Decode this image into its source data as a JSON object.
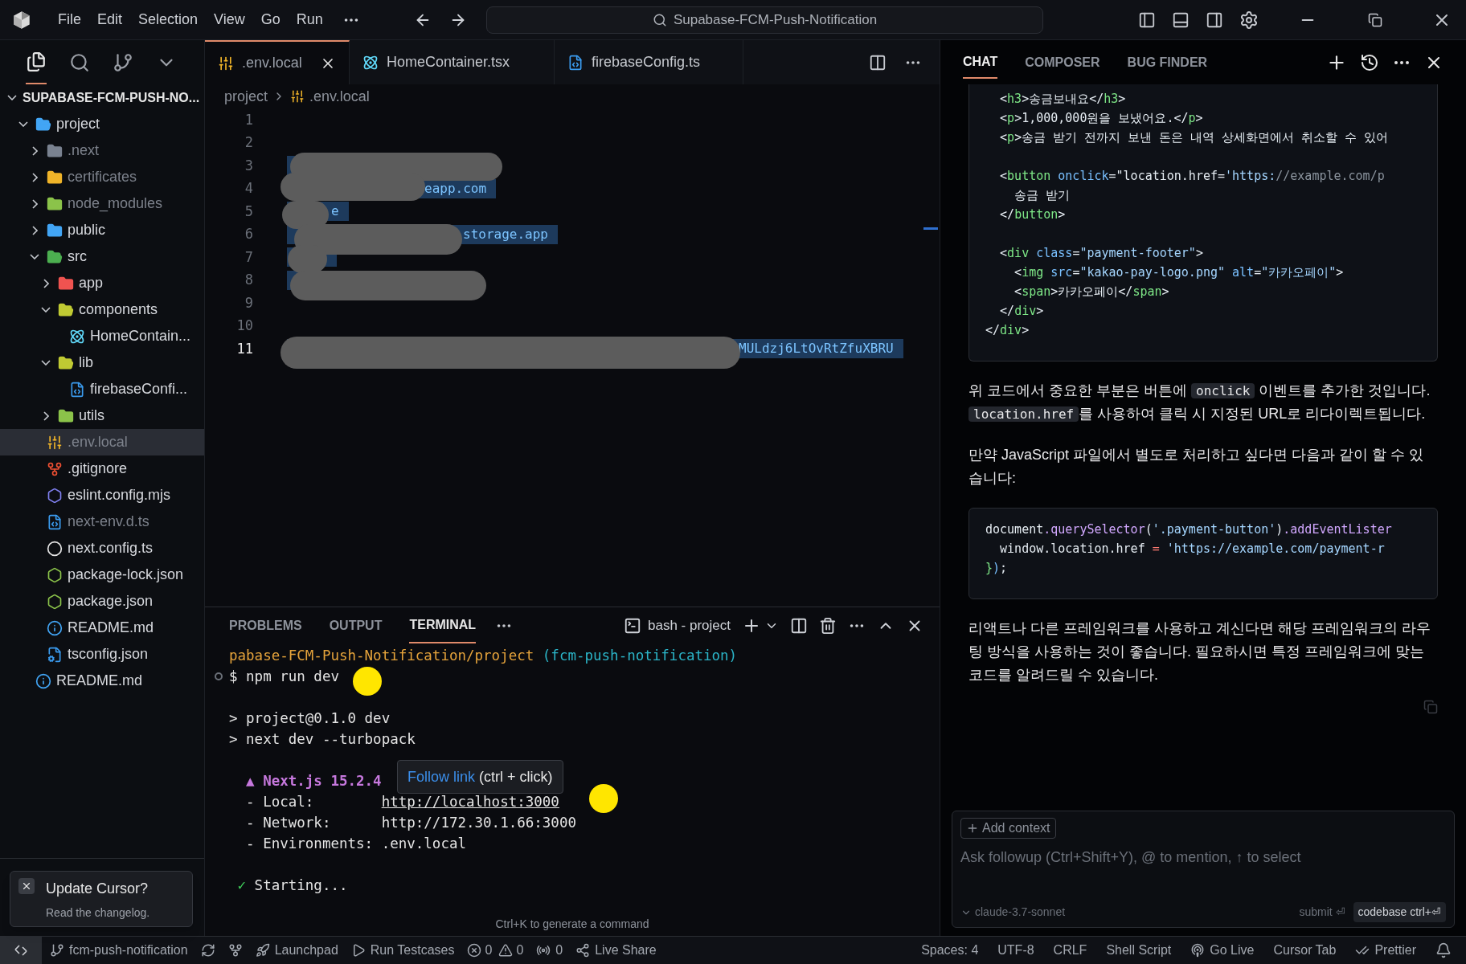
{
  "title_bar": {
    "menus": [
      "File",
      "Edit",
      "Selection",
      "View",
      "Go",
      "Run"
    ],
    "search": "Supabase-FCM-Push-Notification"
  },
  "explorer": {
    "title": "SUPABASE-FCM-PUSH-NO...",
    "tree": [
      {
        "label": "project",
        "kind": "folder",
        "color": "#42a5f5",
        "expanded": true,
        "selected": false,
        "dimmed": false,
        "children": [
          {
            "label": ".next",
            "kind": "folder",
            "color": "#7a8290",
            "expanded": false,
            "selected": false,
            "dimmed": true
          },
          {
            "label": "certificates",
            "kind": "folder",
            "color": "#f0b429",
            "expanded": false,
            "selected": false,
            "dimmed": true
          },
          {
            "label": "node_modules",
            "kind": "folder",
            "color": "#8bc34a",
            "expanded": false,
            "selected": false,
            "dimmed": true
          },
          {
            "label": "public",
            "kind": "folder",
            "color": "#42a5f5",
            "expanded": false,
            "selected": false,
            "dimmed": false
          },
          {
            "label": "src",
            "kind": "folder",
            "color": "#4caf50",
            "expanded": true,
            "selected": false,
            "dimmed": false,
            "children": [
              {
                "label": "app",
                "kind": "folder",
                "color": "#ef5350",
                "expanded": false,
                "selected": false,
                "dimmed": false
              },
              {
                "label": "components",
                "kind": "folder",
                "color": "#c0ca33",
                "expanded": true,
                "selected": false,
                "dimmed": false,
                "children": [
                  {
                    "label": "HomeContain...",
                    "kind": "react",
                    "selected": false,
                    "dimmed": false
                  }
                ]
              },
              {
                "label": "lib",
                "kind": "folder",
                "color": "#c0ca33",
                "expanded": true,
                "selected": false,
                "dimmed": false,
                "children": [
                  {
                    "label": "firebaseConfi...",
                    "kind": "ts",
                    "selected": false,
                    "dimmed": false
                  }
                ]
              },
              {
                "label": "utils",
                "kind": "folder",
                "color": "#8bc34a",
                "expanded": false,
                "selected": false,
                "dimmed": false
              }
            ]
          },
          {
            "label": ".env.local",
            "kind": "env",
            "selected": true,
            "dimmed": true
          },
          {
            "label": ".gitignore",
            "kind": "git",
            "selected": false,
            "dimmed": false
          },
          {
            "label": "eslint.config.mjs",
            "kind": "eslint",
            "selected": false,
            "dimmed": false
          },
          {
            "label": "next-env.d.ts",
            "kind": "ts",
            "selected": false,
            "dimmed": true
          },
          {
            "label": "next.config.ts",
            "kind": "next",
            "selected": false,
            "dimmed": false
          },
          {
            "label": "package-lock.json",
            "kind": "node",
            "selected": false,
            "dimmed": false
          },
          {
            "label": "package.json",
            "kind": "node",
            "selected": false,
            "dimmed": false
          },
          {
            "label": "README.md",
            "kind": "info",
            "selected": false,
            "dimmed": false
          },
          {
            "label": "tsconfig.json",
            "kind": "tsconfig",
            "selected": false,
            "dimmed": false
          }
        ]
      },
      {
        "label": "README.md",
        "kind": "info",
        "selected": false,
        "dimmed": false
      }
    ]
  },
  "toast": {
    "title": "Update Cursor?",
    "message": "Read the changelog."
  },
  "editor": {
    "tabs": [
      {
        "label": ".env.local",
        "kind": "env",
        "selected": true
      },
      {
        "label": "HomeContainer.tsx",
        "kind": "react",
        "selected": false
      },
      {
        "label": "firebaseConfig.ts",
        "kind": "ts",
        "selected": false
      }
    ],
    "breadcrumb": [
      "project",
      ".env.local"
    ],
    "lines": [
      {
        "number": "1",
        "current": false,
        "selected": false,
        "redacted": false
      },
      {
        "number": "2",
        "current": false,
        "selected": false,
        "redacted": false
      },
      {
        "number": "3",
        "current": false,
        "selected": true,
        "redacted": true
      },
      {
        "number": "4",
        "current": false,
        "selected": true,
        "redacted": true,
        "text": "eapp.com"
      },
      {
        "number": "5",
        "current": false,
        "selected": true,
        "redacted": true,
        "text": "e"
      },
      {
        "number": "6",
        "current": false,
        "selected": true,
        "redacted": true,
        "text": "storage.app"
      },
      {
        "number": "7",
        "current": false,
        "selected": true,
        "redacted": true
      },
      {
        "number": "8",
        "current": false,
        "selected": true,
        "redacted": true
      },
      {
        "number": "9",
        "current": false,
        "selected": false,
        "redacted": false
      },
      {
        "number": "10",
        "current": false,
        "selected": false,
        "redacted": false
      },
      {
        "number": "11",
        "current": true,
        "selected": true,
        "redacted": true,
        "text": "MULdzj6LtOvRtZfuXBRU"
      }
    ]
  },
  "panel": {
    "tabs": [
      {
        "label": "PROBLEMS",
        "selected": false
      },
      {
        "label": "OUTPUT",
        "selected": false
      },
      {
        "label": "TERMINAL",
        "selected": true
      }
    ],
    "terminal_name": "bash - project",
    "lines": [
      {
        "kind": "line",
        "marker": false,
        "tokens": [
          {
            "kind": "path",
            "text": "pabase-FCM-Push-Notification/project"
          },
          {
            "kind": "branch",
            "text": " (fcm-push-notification)"
          }
        ]
      },
      {
        "kind": "line",
        "marker": true,
        "tokens": [
          {
            "kind": "text",
            "text": "$ npm run dev"
          }
        ]
      },
      {
        "kind": "blank"
      },
      {
        "kind": "line",
        "marker": false,
        "tokens": [
          {
            "kind": "text",
            "text": "> project@0.1.0 dev"
          }
        ]
      },
      {
        "kind": "line",
        "marker": false,
        "tokens": [
          {
            "kind": "text",
            "text": "> next dev --turbopack"
          }
        ]
      },
      {
        "kind": "blank"
      },
      {
        "kind": "line",
        "marker": false,
        "tokens": [
          {
            "kind": "next",
            "text": "  ▲ Next.js 15.2.4"
          }
        ]
      },
      {
        "kind": "line",
        "marker": false,
        "tokens": [
          {
            "kind": "text",
            "text": "  - Local:        "
          },
          {
            "kind": "link",
            "text": "http://localhost:3000"
          }
        ]
      },
      {
        "kind": "line",
        "marker": false,
        "tokens": [
          {
            "kind": "text",
            "text": "  - Network:      http://172.30.1.66:3000"
          }
        ]
      },
      {
        "kind": "line",
        "marker": false,
        "tokens": [
          {
            "kind": "text",
            "text": "  - Environments: .env.local"
          }
        ]
      },
      {
        "kind": "blank"
      },
      {
        "kind": "line",
        "marker": false,
        "tokens": [
          {
            "kind": "check",
            "text": " ✓"
          },
          {
            "kind": "text",
            "text": " Starting..."
          }
        ]
      }
    ],
    "tooltip": {
      "link": "Follow link",
      "hint": " (ctrl + click)"
    },
    "hint": "Ctrl+K to generate a command"
  },
  "chat": {
    "tabs": [
      {
        "label": "CHAT",
        "selected": true
      },
      {
        "label": "COMPOSER",
        "selected": false
      },
      {
        "label": "BUG FINDER",
        "selected": false
      }
    ],
    "messages": [
      {
        "kind": "code",
        "clipped": true,
        "lines": [
          {
            "kind": "code",
            "tokens": [
              {
                "kind": "punct",
                "text": "  <"
              },
              {
                "kind": "tag",
                "text": "h3"
              },
              {
                "kind": "punct",
                "text": ">송금보내요</"
              },
              {
                "kind": "tag",
                "text": "h3"
              },
              {
                "kind": "punct",
                "text": ">"
              }
            ]
          },
          {
            "kind": "code",
            "tokens": [
              {
                "kind": "punct",
                "text": "  <"
              },
              {
                "kind": "tag",
                "text": "p"
              },
              {
                "kind": "punct",
                "text": ">1,000,000원을 보냈어요.</"
              },
              {
                "kind": "tag",
                "text": "p"
              },
              {
                "kind": "punct",
                "text": ">"
              }
            ]
          },
          {
            "kind": "code",
            "tokens": [
              {
                "kind": "punct",
                "text": "  <"
              },
              {
                "kind": "tag",
                "text": "p"
              },
              {
                "kind": "punct",
                "text": ">송금 받기 전까지 보낸 돈은 내역 상세화면에서 취소할 수 있어"
              }
            ]
          },
          {
            "kind": "blank"
          },
          {
            "kind": "code",
            "tokens": [
              {
                "kind": "punct",
                "text": "  <"
              },
              {
                "kind": "tag",
                "text": "button"
              },
              {
                "kind": "attr",
                "text": " onclick"
              },
              {
                "kind": "punct",
                "text": "=\"location.href="
              },
              {
                "kind": "string",
                "text": "'https:"
              },
              {
                "kind": "comment",
                "text": "//example.com/p"
              }
            ]
          },
          {
            "kind": "code",
            "tokens": [
              {
                "kind": "punct",
                "text": "    송금 받기"
              }
            ]
          },
          {
            "kind": "code",
            "tokens": [
              {
                "kind": "punct",
                "text": "  </"
              },
              {
                "kind": "tag",
                "text": "button"
              },
              {
                "kind": "punct",
                "text": ">"
              }
            ]
          },
          {
            "kind": "blank"
          },
          {
            "kind": "code",
            "tokens": [
              {
                "kind": "punct",
                "text": "  <"
              },
              {
                "kind": "tag",
                "text": "div"
              },
              {
                "kind": "attr",
                "text": " class"
              },
              {
                "kind": "punct",
                "text": "="
              },
              {
                "kind": "string",
                "text": "\"payment-footer\""
              },
              {
                "kind": "punct",
                "text": ">"
              }
            ]
          },
          {
            "kind": "code",
            "tokens": [
              {
                "kind": "punct",
                "text": "    <"
              },
              {
                "kind": "tag",
                "text": "img"
              },
              {
                "kind": "attr",
                "text": " src"
              },
              {
                "kind": "punct",
                "text": "="
              },
              {
                "kind": "string",
                "text": "\"kakao-pay-logo.png\""
              },
              {
                "kind": "attr",
                "text": " alt"
              },
              {
                "kind": "punct",
                "text": "="
              },
              {
                "kind": "string",
                "text": "\"카카오페이\""
              },
              {
                "kind": "punct",
                "text": ">"
              }
            ]
          },
          {
            "kind": "code",
            "tokens": [
              {
                "kind": "punct",
                "text": "    <"
              },
              {
                "kind": "tag",
                "text": "span"
              },
              {
                "kind": "punct",
                "text": ">카카오페이</"
              },
              {
                "kind": "tag",
                "text": "span"
              },
              {
                "kind": "punct",
                "text": ">"
              }
            ]
          },
          {
            "kind": "code",
            "tokens": [
              {
                "kind": "punct",
                "text": "  </"
              },
              {
                "kind": "tag",
                "text": "div"
              },
              {
                "kind": "punct",
                "text": ">"
              }
            ]
          },
          {
            "kind": "code",
            "tokens": [
              {
                "kind": "punct",
                "text": "</"
              },
              {
                "kind": "tag",
                "text": "div"
              },
              {
                "kind": "punct",
                "text": ">"
              }
            ]
          }
        ]
      },
      {
        "kind": "paragraph",
        "segments": [
          {
            "kind": "text",
            "text": "위 코드에서 중요한 부분은 버튼에 "
          },
          {
            "kind": "code",
            "text": "onclick"
          },
          {
            "kind": "text",
            "text": " 이벤트를 추가한 것입니다. "
          },
          {
            "kind": "code",
            "text": "location.href"
          },
          {
            "kind": "text",
            "text": "를 사용하여 클릭 시 지정된 URL로 리다이렉트됩니다."
          }
        ]
      },
      {
        "kind": "paragraph",
        "segments": [
          {
            "kind": "text",
            "text": "만약 JavaScript 파일에서 별도로 처리하고 싶다면 다음과 같이 할 수 있습니다:"
          }
        ]
      },
      {
        "kind": "code",
        "clipped": false,
        "lines": [
          {
            "kind": "code",
            "tokens": [
              {
                "kind": "punct",
                "text": "document"
              },
              {
                "kind": "method",
                "text": ".querySelector"
              },
              {
                "kind": "punct",
                "text": "("
              },
              {
                "kind": "string",
                "text": "'.payment-button'"
              },
              {
                "kind": "punct",
                "text": ")"
              },
              {
                "kind": "method",
                "text": ".addEventLister"
              }
            ]
          },
          {
            "kind": "code",
            "tokens": [
              {
                "kind": "punct",
                "text": "  window.location.href "
              },
              {
                "kind": "op",
                "text": "="
              },
              {
                "kind": "string",
                "text": " 'https://example.com/payment-r"
              }
            ]
          },
          {
            "kind": "code",
            "tokens": [
              {
                "kind": "tag",
                "text": "}"
              },
              {
                "kind": "attr",
                "text": ")"
              },
              {
                "kind": "punct",
                "text": ";"
              }
            ]
          }
        ]
      },
      {
        "kind": "paragraph",
        "segments": [
          {
            "kind": "text",
            "text": "리액트나 다른 프레임워크를 사용하고 계신다면 해당 프레임워크의 라우팅 방식을 사용하는 것이 좋습니다. 필요하시면 특정 프레임워크에 맞는 코드를 알려드릴 수 있습니다."
          }
        ]
      }
    ],
    "input": {
      "add_context": "Add context",
      "placeholder": "Ask followup (Ctrl+Shift+Y), @ to mention, ↑ to select",
      "model": "claude-3.7-sonnet",
      "submit": "submit ⏎",
      "codebase": "codebase ctrl+⏎"
    }
  },
  "status_bar": {
    "left": [
      {
        "kind": "branch",
        "text": "fcm-push-notification"
      },
      {
        "kind": "launchpad",
        "text": "Launchpad"
      },
      {
        "kind": "testcases",
        "text": "Run Testcases"
      },
      {
        "kind": "problems",
        "errors": "0",
        "warnings": "0"
      },
      {
        "kind": "ports",
        "text": "0"
      },
      {
        "kind": "liveshare",
        "text": "Live Share"
      }
    ],
    "right": [
      {
        "kind": "plain",
        "text": "Spaces: 4"
      },
      {
        "kind": "plain",
        "text": "UTF-8"
      },
      {
        "kind": "plain",
        "text": "CRLF"
      },
      {
        "kind": "plain",
        "text": "Shell Script"
      },
      {
        "kind": "golive",
        "text": "Go Live"
      },
      {
        "kind": "plain",
        "text": "Cursor Tab"
      },
      {
        "kind": "prettier",
        "text": "Prettier"
      }
    ]
  }
}
